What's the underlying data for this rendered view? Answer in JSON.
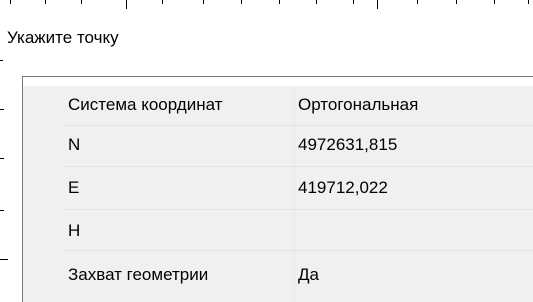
{
  "prompt": {
    "text": "Укажите точку"
  },
  "properties": {
    "rows": [
      {
        "name": "Система координат",
        "value": "Ортогональная"
      },
      {
        "name": "N",
        "value": "4972631,815"
      },
      {
        "name": "E",
        "value": "419712,022"
      },
      {
        "name": "H",
        "value": ""
      },
      {
        "name": "Захват геометрии",
        "value": "Да"
      }
    ]
  },
  "colors": {
    "grid_background": "#f0f0f0",
    "panel_border": "#7a7a7a",
    "ruler_ink": "#000000"
  }
}
